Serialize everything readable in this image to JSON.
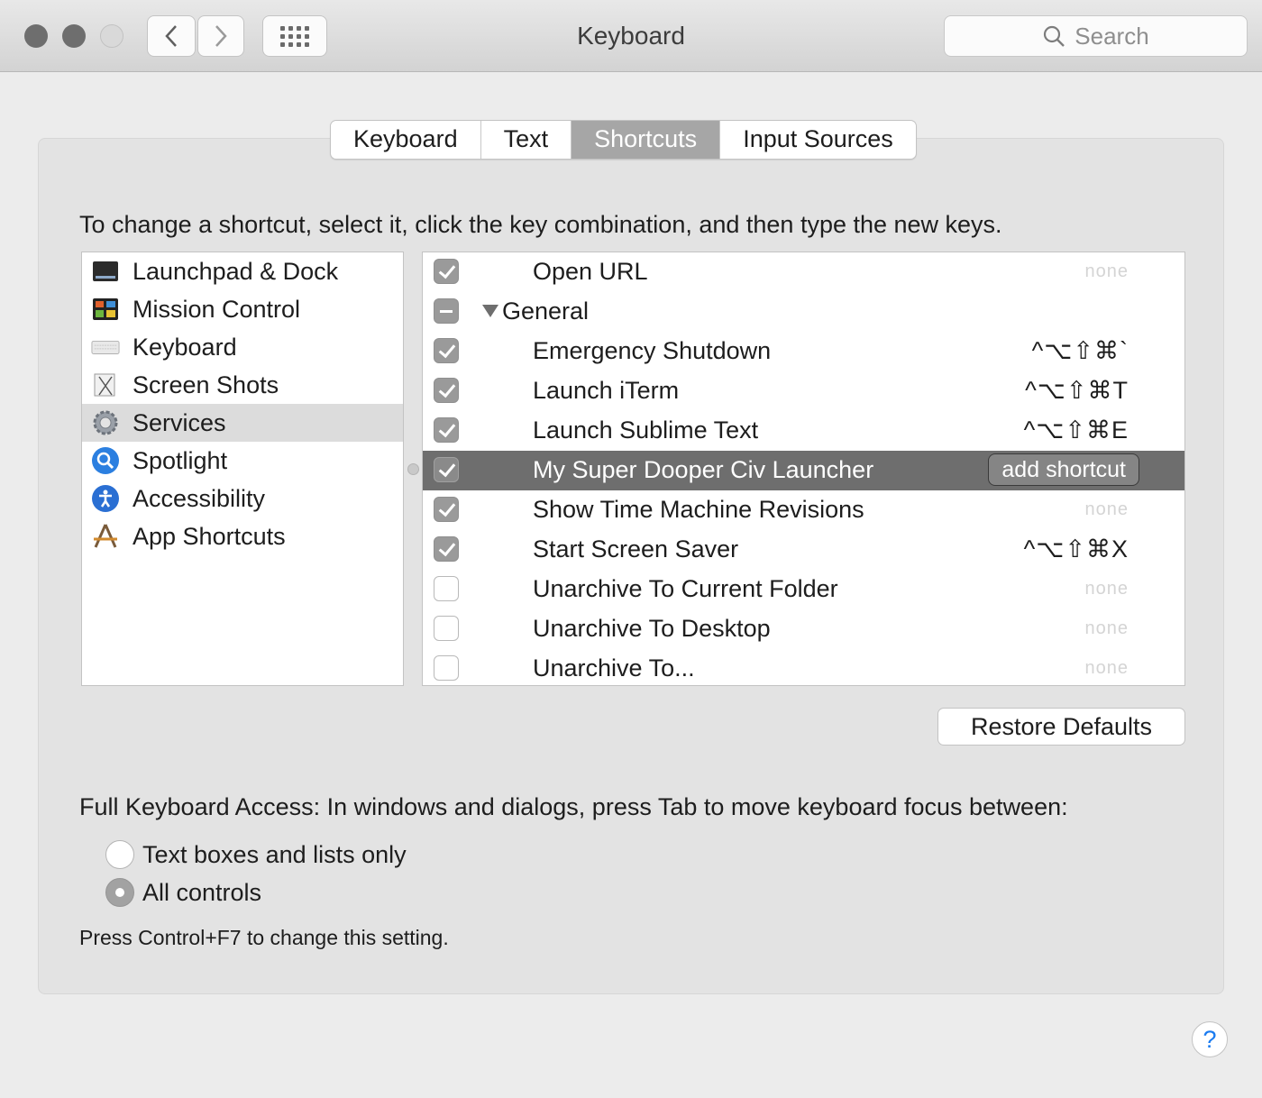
{
  "window": {
    "title": "Keyboard"
  },
  "toolbar": {
    "back_icon": "chevron-left-icon",
    "forward_icon": "chevron-right-icon",
    "show_all_icon": "grid-icon"
  },
  "search": {
    "placeholder": "Search"
  },
  "tabs": [
    {
      "label": "Keyboard",
      "active": false
    },
    {
      "label": "Text",
      "active": false
    },
    {
      "label": "Shortcuts",
      "active": true
    },
    {
      "label": "Input Sources",
      "active": false
    }
  ],
  "instructions": "To change a shortcut, select it, click the key combination, and then type the new keys.",
  "categories": [
    {
      "label": "Launchpad & Dock",
      "icon": "launchpad-dock-icon"
    },
    {
      "label": "Mission Control",
      "icon": "mission-control-icon"
    },
    {
      "label": "Keyboard",
      "icon": "keyboard-icon"
    },
    {
      "label": "Screen Shots",
      "icon": "screen-shots-icon"
    },
    {
      "label": "Services",
      "icon": "gear-icon",
      "selected": true
    },
    {
      "label": "Spotlight",
      "icon": "spotlight-icon"
    },
    {
      "label": "Accessibility",
      "icon": "accessibility-icon"
    },
    {
      "label": "App Shortcuts",
      "icon": "app-shortcuts-icon"
    }
  ],
  "shortcuts": [
    {
      "name": "Open URL",
      "keys": "none",
      "checked": true
    },
    {
      "name": "General",
      "group": true,
      "state": "mixed"
    },
    {
      "name": "Emergency Shutdown",
      "keys": "^⌥⇧⌘`",
      "checked": true
    },
    {
      "name": "Launch iTerm",
      "keys": "^⌥⇧⌘T",
      "checked": true
    },
    {
      "name": "Launch Sublime Text",
      "keys": "^⌥⇧⌘E",
      "checked": true
    },
    {
      "name": "My Super Dooper Civ Launcher",
      "keys": "add shortcut",
      "checked": true,
      "selected": true
    },
    {
      "name": "Show Time Machine Revisions",
      "keys": "none",
      "checked": true
    },
    {
      "name": "Start Screen Saver",
      "keys": "^⌥⇧⌘X",
      "checked": true
    },
    {
      "name": "Unarchive To Current Folder",
      "keys": "none",
      "checked": false
    },
    {
      "name": "Unarchive To Desktop",
      "keys": "none",
      "checked": false
    },
    {
      "name": "Unarchive To...",
      "keys": "none",
      "checked": false
    }
  ],
  "restore_defaults": "Restore Defaults",
  "full_keyboard_access": {
    "label": "Full Keyboard Access: In windows and dialogs, press Tab to move keyboard focus between:",
    "options": [
      {
        "label": "Text boxes and lists only",
        "selected": false
      },
      {
        "label": "All controls",
        "selected": true
      }
    ],
    "hint": "Press Control+F7 to change this setting."
  },
  "help": "?"
}
